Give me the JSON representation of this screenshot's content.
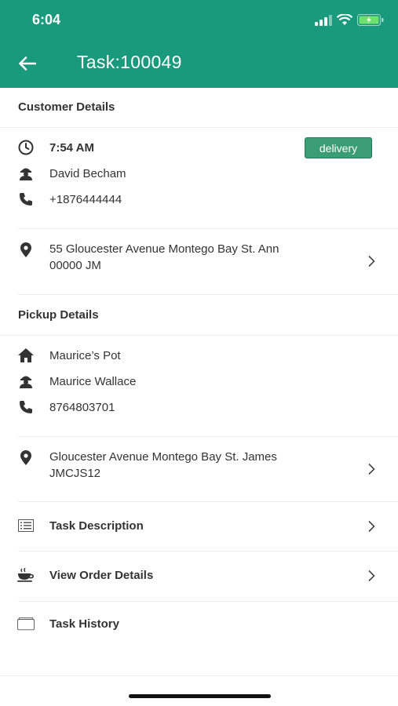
{
  "status_bar": {
    "time": "6:04"
  },
  "header": {
    "title": "Task:100049"
  },
  "customer": {
    "section_title": "Customer Details",
    "time": "7:54 AM",
    "badge": "delivery",
    "name": "David Becham",
    "phone": "+1876444444",
    "address_line1": "55 Gloucester Avenue Montego Bay St. Ann",
    "address_line2": "00000 JM"
  },
  "pickup": {
    "section_title": "Pickup Details",
    "place": "Maurice’s Pot",
    "name": "Maurice Wallace",
    "phone": "8764803701",
    "address_line1": "Gloucester Avenue Montego Bay St. James",
    "address_line2": "JMCJS12"
  },
  "menu": {
    "task_description": "Task Description",
    "view_order_details": "View Order Details",
    "task_history": "Task History"
  },
  "colors": {
    "header": "#1a9a7c",
    "badge": "#3a9d74"
  }
}
